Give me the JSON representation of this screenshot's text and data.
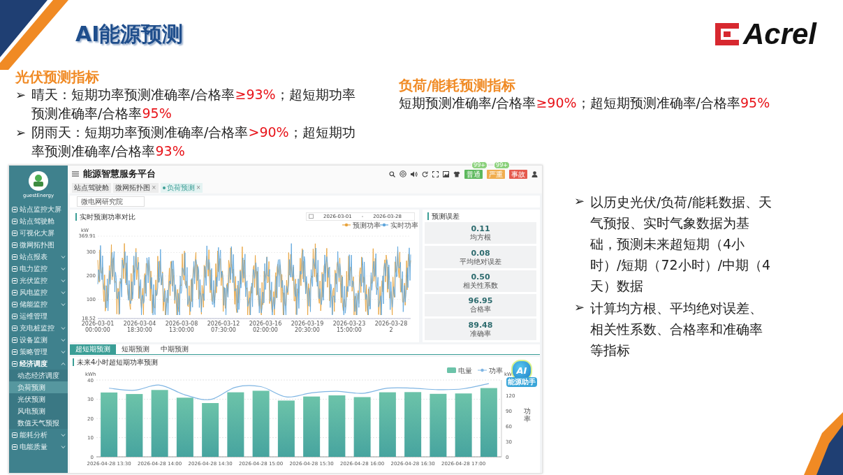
{
  "slide": {
    "title": "AI能源预测",
    "logo": "Acrel"
  },
  "pv_indicators": {
    "heading": "光伏预测指标",
    "bullets": [
      {
        "marker": "➢",
        "segments": [
          {
            "text": "晴天：短期功率预测准确率/合格率",
            "highlight": false
          },
          {
            "text": "≥93%",
            "highlight": true
          },
          {
            "text": "；超短期功率预测准确率/合格率",
            "highlight": false
          },
          {
            "text": "95%",
            "highlight": true
          }
        ]
      },
      {
        "marker": "➢",
        "segments": [
          {
            "text": "阴雨天：短期功率预测准确率/合格率",
            "highlight": false
          },
          {
            "text": ">90%",
            "highlight": true
          },
          {
            "text": "；超短期功率预测准确率/合格率",
            "highlight": false
          },
          {
            "text": "93%",
            "highlight": true
          }
        ]
      }
    ]
  },
  "load_indicators": {
    "heading": "负荷/能耗预测指标",
    "segments": [
      {
        "text": "短期预测准确率/合格率",
        "highlight": false
      },
      {
        "text": "≥90%",
        "highlight": true
      },
      {
        "text": "；超短期预测准确率/合格率",
        "highlight": false
      },
      {
        "text": "95%",
        "highlight": true
      }
    ]
  },
  "dashboard": {
    "user": "guestEnergy",
    "app_title": "能源智慧服务平台",
    "menu": [
      {
        "label": "站点监控大屏",
        "selected": false
      },
      {
        "label": "站点驾驶舱",
        "selected": false
      },
      {
        "label": "可视化大屏",
        "selected": false
      },
      {
        "label": "微网拓扑图",
        "selected": false
      },
      {
        "label": "站点报表",
        "selected": false,
        "expanded": false
      },
      {
        "label": "电力监控",
        "selected": false,
        "expanded": false
      },
      {
        "label": "光伏监控",
        "selected": false,
        "expanded": false
      },
      {
        "label": "风电监控",
        "selected": false,
        "expanded": false
      },
      {
        "label": "储能监控",
        "selected": false,
        "expanded": false
      },
      {
        "label": "运维管理",
        "selected": false
      },
      {
        "label": "充电桩监控",
        "selected": false,
        "expanded": false
      },
      {
        "label": "设备监测",
        "selected": false,
        "expanded": false
      },
      {
        "label": "策略管理",
        "selected": false,
        "expanded": false
      },
      {
        "label": "经济调度",
        "selected": false,
        "expanded": true,
        "children": [
          {
            "label": "动态经济调度",
            "selected": false
          },
          {
            "label": "负荷预测",
            "selected": true
          },
          {
            "label": "光伏预测",
            "selected": false
          },
          {
            "label": "风电预测",
            "selected": false
          },
          {
            "label": "数值天气预报",
            "selected": false
          }
        ]
      },
      {
        "label": "能耗分析",
        "selected": false,
        "expanded": false
      },
      {
        "label": "电能质量",
        "selected": false,
        "expanded": false
      }
    ],
    "alarm_badges": [
      {
        "label": "普通",
        "count": "99+",
        "color": "#5cb85c"
      },
      {
        "label": "严重",
        "count": "99+",
        "color": "#f0ad4e"
      },
      {
        "label": "事故",
        "color": "#e55a4e"
      }
    ],
    "open_tabs": [
      {
        "label": "站点驾驶舱",
        "selected": false
      },
      {
        "label": "微网拓扑图",
        "close": "×",
        "selected": false
      },
      {
        "label": "负荷预测",
        "close": "×",
        "selected": true
      }
    ],
    "site_select": {
      "value": "微电网研究院"
    },
    "realtime_chart": {
      "title": "实时预测功率对比",
      "date_start": "2026-03-01",
      "date_separator": "-",
      "date_end": "2026-03-28",
      "legend": [
        {
          "name": "预测功率",
          "color": "#e8a33c"
        },
        {
          "name": "实时功率",
          "color": "#5fa6dc"
        }
      ],
      "y_unit": "kW",
      "y_axis_labels": [
        "369.91",
        "300",
        "200",
        "100",
        "18.52"
      ],
      "x_axis_labels": [
        "2026-03-01 00:00:00",
        "2026-03-04 18:30:00",
        "2026-03-08 13:00:00",
        "2026-03-12 07:30:00",
        "2026-03-16 02:00:00",
        "2026-03-19 20:30:00",
        "2026-03-23 15:00:00",
        "2026-03-28 2"
      ]
    },
    "error_panel": {
      "title": "预测误差",
      "metrics": [
        {
          "value": "0.11",
          "label": "均方根"
        },
        {
          "value": "0.08",
          "label": "平均绝对误差"
        },
        {
          "value": "0.50",
          "label": "相关性系数"
        },
        {
          "value": "96.95",
          "label": "合格率"
        },
        {
          "value": "89.48",
          "label": "准确率"
        }
      ]
    },
    "forecast_tabs": [
      {
        "label": "超短期预测",
        "selected": true
      },
      {
        "label": "短期预测",
        "selected": false
      },
      {
        "label": "中期预测",
        "selected": false
      }
    ],
    "forecast_chart": {
      "title": "未来4小时超短期功率预测",
      "energy_chart": {
        "chart_data": {
          "type": "bar",
          "ylabel": "kWh",
          "ylim": [
            0,
            40
          ],
          "yticks": [
            0,
            10,
            20,
            30,
            40
          ],
          "grid": true,
          "categories": [
            "2026-04-28 13:30",
            null,
            "2026-04-28 14:00",
            null,
            "2026-04-28 14:30",
            null,
            "2026-04-28 15:00",
            null,
            "2026-04-28 15:30",
            null,
            "2026-04-28 16:00",
            null,
            "2026-04-28 16:30",
            null,
            "2026-04-28 17:00",
            null
          ],
          "series": [
            {
              "name": "电量",
              "color": "#6cc3a9",
              "values": [
                33.5,
                32.7,
                34.8,
                30.8,
                28.0,
                33.6,
                34.4,
                29.3,
                31.4,
                32.0,
                31.1,
                33.6,
                33.7,
                32.8,
                33.0,
                35.8
              ]
            }
          ]
        }
      },
      "power_chart": {
        "unit": "kW",
        "chart_data": {
          "type": "line",
          "ylabel": "功率",
          "ylim": [
            0,
            150
          ],
          "yticks": [
            0,
            30,
            60,
            90,
            120
          ],
          "series": [
            {
              "name": "功率",
              "color": "#7fb5e3",
              "values": [
                134,
                130,
                140,
                121,
                112,
                136,
                137,
                117,
                125,
                128,
                124,
                134,
                134,
                131,
                133,
                143
              ]
            }
          ]
        }
      }
    },
    "assistant": {
      "badge": "AI",
      "label": "能源助手"
    }
  },
  "features": [
    {
      "marker": "➢",
      "text": "以历史光伏/负荷/能耗数据、天气预报、实时气象数据为基础，预测未来超短期（4小时）/短期（72小时）/中期（4天）数据"
    },
    {
      "marker": "➢",
      "text": "计算均方根、平均绝对误差、相关性系数、合格率和准确率等指标"
    }
  ]
}
